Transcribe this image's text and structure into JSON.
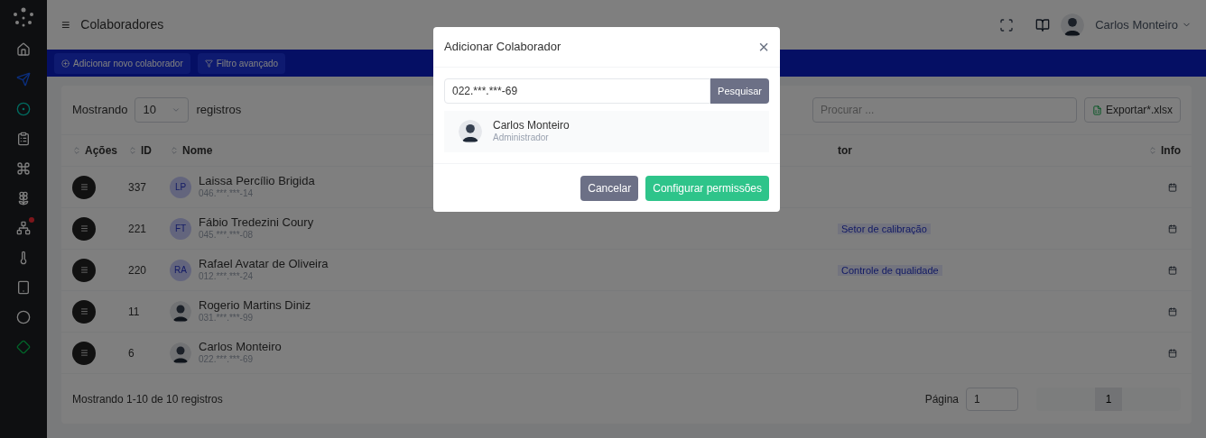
{
  "header": {
    "menu_icon": "≡",
    "title": "Colaboradores",
    "user_name": "Carlos Monteiro"
  },
  "action_bar": {
    "buttons": [
      "Adicionar novo colaborador",
      "Filtro avançado"
    ]
  },
  "table_card": {
    "show_label": "Mostrando",
    "page_size": "10",
    "records_label": "registros",
    "search_placeholder": "Procurar ...",
    "export_button": "Exportar*.xlsx",
    "columns": [
      "Ações",
      "ID",
      "Nome",
      "tor",
      "Info"
    ],
    "rows": [
      {
        "id": "337",
        "name": "Laissa Percílio Brigida",
        "cpf": "046.***.***-14",
        "avatar": {
          "kind": "initials",
          "text": "LP"
        }
      },
      {
        "id": "221",
        "name": "Fábio Tredezini Coury",
        "cpf": "045.***.***-08",
        "avatar": {
          "kind": "initials",
          "text": "FT"
        },
        "sector": "Setor de calibração"
      },
      {
        "id": "220",
        "name": "Rafael Avatar de Oliveira",
        "cpf": "012.***.***-24",
        "avatar": {
          "kind": "initials",
          "text": "RA"
        },
        "sector": "Controle de qualidade"
      },
      {
        "id": "11",
        "name": "Rogerio Martins Diniz",
        "cpf": "031.***.***-99",
        "avatar": {
          "kind": "photo"
        }
      },
      {
        "id": "6",
        "name": "Carlos Monteiro",
        "cpf": "022.***.***-69",
        "avatar": {
          "kind": "photo"
        }
      }
    ],
    "footer_text": "Mostrando 1-10 de 10 registros",
    "page_label": "Página",
    "page_value": "1",
    "pages": [
      {
        "label": "1",
        "selected": true
      }
    ]
  },
  "modal": {
    "title": "Adicionar Colaborador",
    "close": "×",
    "search_value": "022.***.***-69",
    "search_button": "Pesquisar",
    "result": {
      "name": "Carlos Monteiro",
      "role": "Administrador"
    },
    "buttons": [
      {
        "label": "Cancelar",
        "kind": "secondary"
      },
      {
        "label": "Configurar permissões",
        "kind": "primary"
      }
    ]
  }
}
